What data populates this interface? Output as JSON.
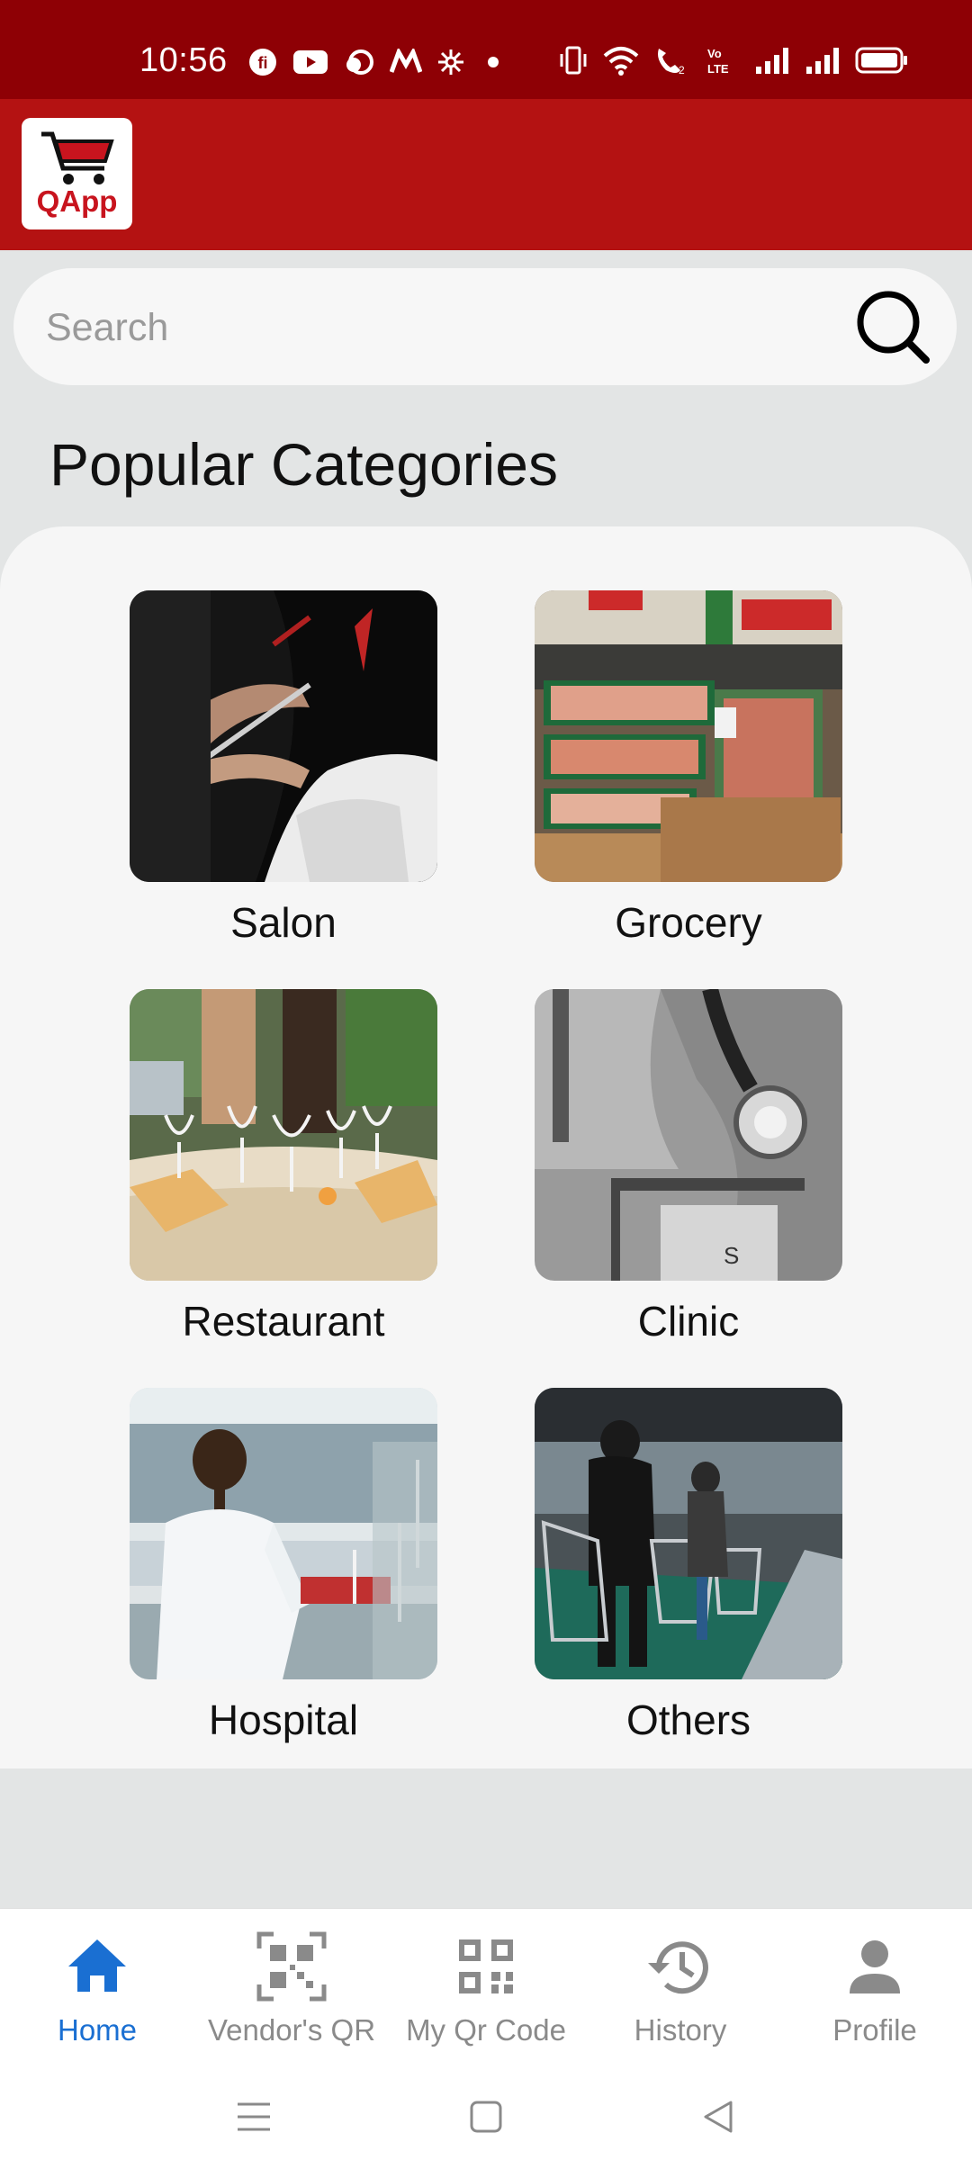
{
  "status_bar": {
    "time": "10:56"
  },
  "app_bar": {
    "logo_text": "QApp"
  },
  "search": {
    "placeholder": "Search"
  },
  "section": {
    "title": "Popular Categories"
  },
  "categories": [
    {
      "label": "Salon",
      "image": "salon-photo"
    },
    {
      "label": "Grocery",
      "image": "grocery-photo"
    },
    {
      "label": "Restaurant",
      "image": "restaurant-photo"
    },
    {
      "label": "Clinic",
      "image": "clinic-photo"
    },
    {
      "label": "Hospital",
      "image": "hospital-photo"
    },
    {
      "label": "Others",
      "image": "others-photo"
    }
  ],
  "bottom_nav": [
    {
      "label": "Home",
      "icon": "home-icon",
      "active": true
    },
    {
      "label": "Vendor's QR",
      "icon": "qr-scan-icon",
      "active": false
    },
    {
      "label": "My Qr Code",
      "icon": "qr-code-icon",
      "active": false
    },
    {
      "label": "History",
      "icon": "history-icon",
      "active": false
    },
    {
      "label": "Profile",
      "icon": "person-icon",
      "active": false
    }
  ],
  "colors": {
    "status_bar": "#8e0005",
    "app_bar": "#b41212",
    "active_nav": "#1a6fd2",
    "inactive_nav": "#8a8a8a"
  }
}
